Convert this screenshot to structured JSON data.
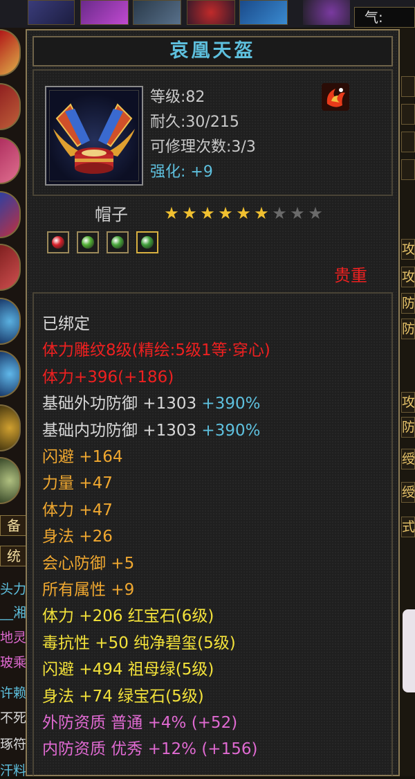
{
  "background": {
    "qi_label": "气:",
    "left_labels": [
      "备",
      "统"
    ],
    "left_texts": [
      "头力",
      "__湘",
      "地灵",
      "玻乘",
      "许赖",
      "不死",
      "琢符",
      "汗料"
    ],
    "right_texts": [
      "攻",
      "攻",
      "防",
      "防",
      "攻",
      "防",
      "绶",
      "绶",
      "式"
    ]
  },
  "item": {
    "name": "哀凰天盔",
    "level_label": "等级",
    "level_value": ":82",
    "durability_label": "耐久",
    "durability_value": ":30/215",
    "repair_label": "可修理次数",
    "repair_value": ":3/3",
    "enhance_label": "强化:",
    "enhance_value": "+9",
    "type": "帽子",
    "stars_filled": 6,
    "stars_total": 9,
    "rarity": "贵重",
    "gems": [
      {
        "name": "red-gem",
        "color": "#d8202a"
      },
      {
        "name": "green-gem",
        "color": "#52b034"
      },
      {
        "name": "green-gem",
        "color": "#48a63a"
      },
      {
        "name": "jade-gem",
        "color": "#3f9e3a"
      }
    ]
  },
  "details": [
    {
      "text": "已绑定",
      "color": "white"
    },
    {
      "text": "体力雕纹8级(精绘:5级1等·穿心)",
      "color": "red"
    },
    {
      "text": "体力+396(+186)",
      "color": "red"
    },
    {
      "text": "基础外功防御 +1303",
      "extra": " +390%",
      "color": "white"
    },
    {
      "text": "基础内功防御 +1303",
      "extra": " +390%",
      "color": "white"
    },
    {
      "text": "闪避 +164",
      "color": "orange"
    },
    {
      "text": "力量 +47",
      "color": "orange"
    },
    {
      "text": "体力 +47",
      "color": "orange"
    },
    {
      "text": "身法 +26",
      "color": "orange"
    },
    {
      "text": "会心防御 +5",
      "color": "orange"
    },
    {
      "text": "所有属性 +9",
      "color": "orange"
    },
    {
      "text": "体力 +206 红宝石(6级)",
      "color": "yellow"
    },
    {
      "text": "毒抗性 +50 纯净碧玺(5级)",
      "color": "yellow"
    },
    {
      "text": "闪避 +494 祖母绿(5级)",
      "color": "yellow"
    },
    {
      "text": "身法 +74 绿宝石(5级)",
      "color": "yellow"
    },
    {
      "text": "外防资质  普通 +4% (+52)",
      "color": "pink"
    },
    {
      "text": "内防资质  优秀 +12% (+156)",
      "color": "pink"
    }
  ],
  "colors": {
    "title": "#5ec0de",
    "red": "#ee2020",
    "orange": "#f0a830",
    "yellow": "#f3e23a",
    "cyan": "#5ec0de",
    "pink": "#e06ad2",
    "star_on": "#f0c030",
    "star_off": "#6a6a6a"
  }
}
